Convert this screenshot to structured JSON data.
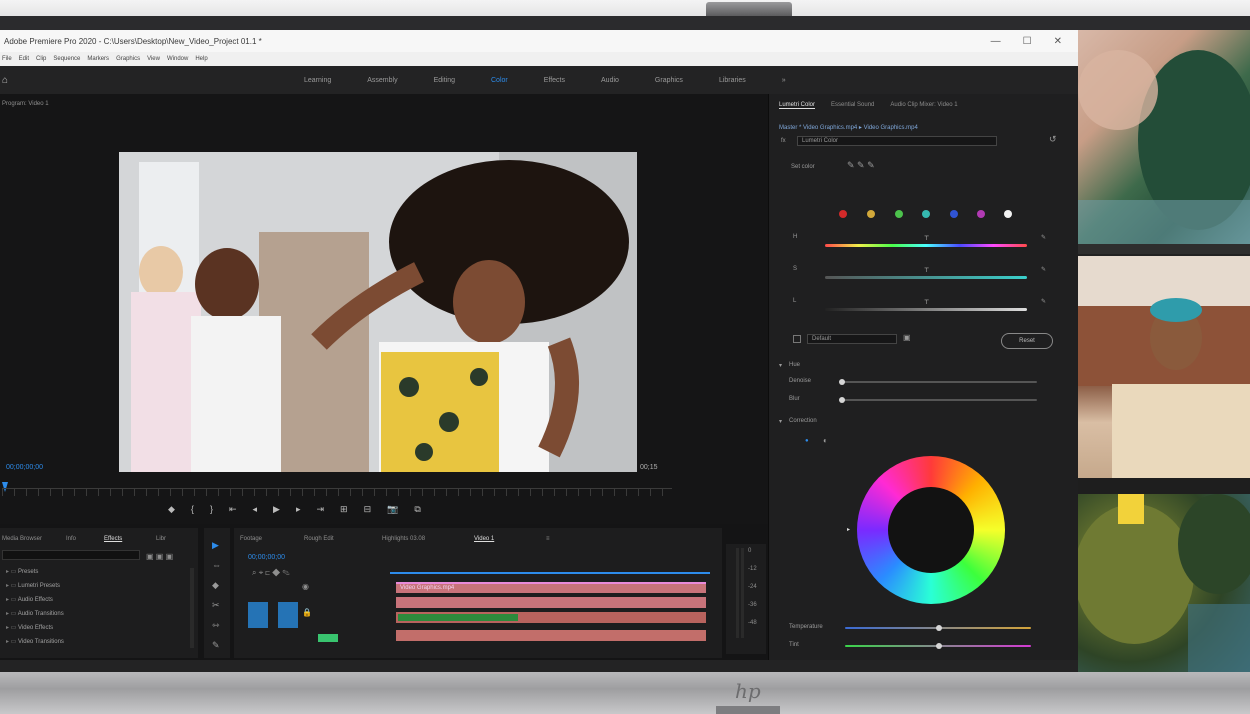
{
  "window": {
    "title": "Adobe Premiere Pro 2020 - C:\\Users\\Desktop\\New_Video_Project 01.1 *",
    "controls": [
      "—",
      "☐",
      "✕"
    ]
  },
  "menu": [
    "File",
    "Edit",
    "Clip",
    "Sequence",
    "Markers",
    "Graphics",
    "View",
    "Window",
    "Help"
  ],
  "workspaces": {
    "tabs": [
      "Learning",
      "Assembly",
      "Editing",
      "Color",
      "Effects",
      "Audio",
      "Graphics",
      "Libraries",
      "»"
    ],
    "active": "Color"
  },
  "program_monitor": {
    "tab": "Program: Video 1",
    "timecode_left": "00;00;00;00",
    "timecode_right": "00;15",
    "transport": [
      "◆",
      "{",
      "}",
      "⇤",
      "◂",
      "▶",
      "▸",
      "⇥",
      "⊞",
      "⊟",
      "📷",
      "⧉"
    ]
  },
  "lumetri": {
    "tabs": [
      "Lumetri Color",
      "Essential Sound",
      "Audio Clip Mixer: Video 1"
    ],
    "active_tab": "Lumetri Color",
    "source_line": "Master * Video Graphics.mp4  ▸  Video Graphics.mp4",
    "fx_dropdown": "Lumetri Color",
    "hsl_label": "Set color",
    "hsl_rows": [
      "H",
      "S",
      "L"
    ],
    "color_dots": [
      "#d32a2a",
      "#d2a83a",
      "#4cc24c",
      "#35b9b0",
      "#3054d4",
      "#b13ab3",
      "#f2f2f2"
    ],
    "preset_dropdown": "Default",
    "reset_button": "Reset",
    "section_hue": "Hue",
    "saturation_rows": [
      "Denoise",
      "Blur"
    ],
    "section_correction": "Correction",
    "bottom_sliders": [
      "Temperature",
      "Tint"
    ]
  },
  "project_panel": {
    "tabs": [
      "Media Browser",
      "Info",
      "Effects",
      "Libr"
    ],
    "active_tab": "Effects",
    "items": [
      "Presets",
      "Lumetri Presets",
      "Audio Effects",
      "Audio Transitions",
      "Video Effects",
      "Video Transitions"
    ]
  },
  "timeline": {
    "tabs": [
      "Footage",
      "Rough Edit",
      "Highlights 03.08",
      "Video 1",
      "≡"
    ],
    "active_tab": "Video 1",
    "timecode": "00;00;00;00",
    "clips": [
      {
        "label": "Video Graphics.mp4",
        "color": "#c8737a"
      },
      {
        "label": "",
        "color": "#c8737a"
      },
      {
        "label": "",
        "color": "#b8635e"
      },
      {
        "label": "",
        "color": "#c26e6a"
      }
    ],
    "meter_labels": [
      "0",
      "-12",
      "-24",
      "-36",
      "-48"
    ]
  },
  "tools": [
    "▶",
    "⇔",
    "◆",
    "✂",
    "⇿",
    "✎"
  ]
}
